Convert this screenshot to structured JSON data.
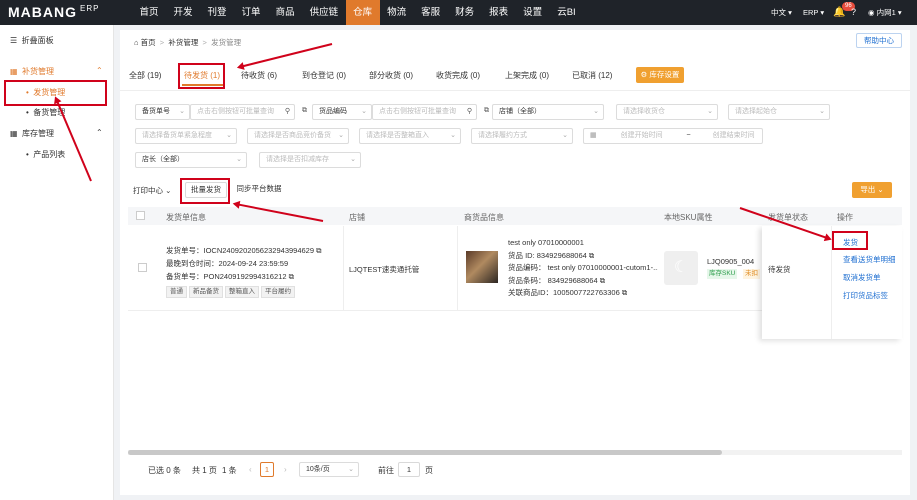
{
  "app": {
    "logo": "MABANG",
    "logo_suffix": "ERP"
  },
  "topnav": {
    "items": [
      "首页",
      "开发",
      "刊登",
      "订单",
      "商品",
      "供应链",
      "仓库",
      "物流",
      "客服",
      "财务",
      "报表",
      "设置",
      "云BI"
    ],
    "active_index": 6,
    "lang": "中文",
    "erp": "ERP",
    "notif_count": "96",
    "user": "内网1"
  },
  "sidebar": {
    "collapse": "折叠面板",
    "group1": "补货管理",
    "item_shipping": "发货管理",
    "item_stock": "备货管理",
    "group2": "库存管理",
    "item_products": "产品列表"
  },
  "breadcrumb": {
    "home": "首页",
    "l1": "补货管理",
    "l2": "发货管理",
    "help": "帮助中心"
  },
  "tabs": [
    "全部 (19)",
    "待发货 (1)",
    "待收货 (6)",
    "到仓登记 (0)",
    "部分收货 (0)",
    "收货完成 (0)",
    "上架完成 (0)",
    "已取消 (12)"
  ],
  "stock_setting": "库存设置",
  "filters": {
    "order_no_type": "备货单号",
    "order_no_ph": "点击右侧按钮可批量查询",
    "goods_type": "货品编码",
    "goods_ph": "点击右侧按钮可批量查询",
    "shop": "店铺（全部）",
    "warehouse_ph": "请选择收货仓",
    "origin_ph": "请选择起始仓",
    "urgency_ph": "请选择备货单紧急程度",
    "price_ph": "请选择是否商品竞价备货",
    "whole_ph": "请选择是否整箱直入",
    "perform_ph": "请选择履约方式",
    "start_ph": "创建开始时间",
    "range_sep": "~",
    "end_ph": "创建结束时间",
    "owner": "店长（全部）",
    "deduct_ph": "请选择是否扣减库存"
  },
  "toolbar": {
    "print": "打印中心",
    "batch": "批量发货",
    "sync": "同步平台数据",
    "export": "导出"
  },
  "table": {
    "headers": [
      "发货单信息",
      "店铺",
      "商货品信息",
      "本地SKU属性",
      "发货单状态",
      "操作"
    ],
    "row": {
      "ship_no_label": "发货单号：",
      "ship_no": "IOCN2409202056232943994629",
      "deadline_label": "最晚到仓时间：",
      "deadline": "2024-09-24 23:59:59",
      "stock_no_label": "备货单号：",
      "stock_no": "PON2409192994316212",
      "tags": [
        "普通",
        "新品备货",
        "整箱直入",
        "平台履约"
      ],
      "shop": "LJQTEST速卖通托管",
      "product_name": "test only 07010000001",
      "goods_id": "货品 ID: 834929688064",
      "goods_code": "货品编码：  test only 07010000001-cutom1-...",
      "goods_barcode": "货品条码：  834929688064",
      "linked_id": "关联商品ID：1005007722763306",
      "sku": "LJQ0905_004",
      "sku_tag1": "库存SKU",
      "sku_tag2": "未扣",
      "status": "待发货",
      "actions": [
        "发货",
        "查看送货单明细",
        "取消发货单",
        "打印货品标签"
      ]
    }
  },
  "pager": {
    "selected": "已选 0 条",
    "total": "共 1 页",
    "count": "1 条",
    "page": "1",
    "per_page": "10条/页",
    "goto": "前往",
    "goto_val": "1",
    "page_suffix": "页"
  }
}
